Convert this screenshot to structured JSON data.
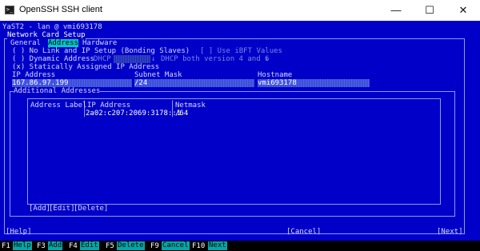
{
  "window": {
    "app_icon": "terminal-icon",
    "title": "OpenSSH SSH client",
    "controls": [
      "minimize-icon",
      "maximize-icon",
      "close-icon"
    ],
    "min_glyph": "—",
    "max_glyph": "☐",
    "close_glyph": "✕"
  },
  "terminal": {
    "header": "YaST2 - lan @ vmi693178",
    "dialog_title": "Network Card Setup",
    "tabs": [
      "General",
      "Address",
      "Hardware"
    ],
    "options": {
      "no_link": "( ) No Link and IP Setup (Bonding Slaves)",
      "ibft": "[ ] Use iBFT Values",
      "dynamic": "( ) Dynamic Address",
      "dhcp": "DHCP",
      "dhcp_version": "DHCP both version 4 and 6",
      "static": "(x) Statically Assigned IP Address"
    },
    "ip_label": "IP Address",
    "ip_value": "167.86.97.199",
    "mask_label": "Subnet Mask",
    "mask_value": "/24",
    "host_label": "Hostname",
    "host_value": "vmi693178",
    "additional_title": "Additional Addresses",
    "table": {
      "headers": [
        "Address Label",
        "IP Address",
        "Netmask"
      ],
      "rows": [
        {
          "label": "",
          "ip": "2a02:c207:2069:3178::1",
          "mask": "/64"
        }
      ]
    },
    "table_buttons": [
      "[Add]",
      "[Edit]",
      "[Delete]"
    ],
    "help": "[Help]",
    "cancel": "[Cancel]",
    "next": "[Next]"
  },
  "statusbar": [
    {
      "key": "F1",
      "label": "Help"
    },
    {
      "key": "F3",
      "label": "Add"
    },
    {
      "key": "F4",
      "label": "Edit"
    },
    {
      "key": "F5",
      "label": "Delete"
    },
    {
      "key": "F9",
      "label": "Cancel"
    },
    {
      "key": "F10",
      "label": "Next"
    }
  ],
  "colors": {
    "background": "#0000c8",
    "text": "#d8d8ff",
    "highlight": "#ffffff",
    "accent": "#00c8c8",
    "statusbar": "#000000"
  }
}
